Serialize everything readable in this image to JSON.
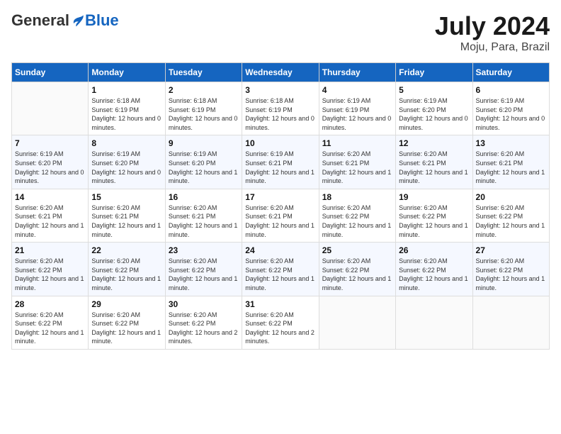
{
  "header": {
    "logo_general": "General",
    "logo_blue": "Blue",
    "month_title": "July 2024",
    "location": "Moju, Para, Brazil"
  },
  "days_of_week": [
    "Sunday",
    "Monday",
    "Tuesday",
    "Wednesday",
    "Thursday",
    "Friday",
    "Saturday"
  ],
  "weeks": [
    [
      {
        "day": "",
        "info": ""
      },
      {
        "day": "1",
        "info": "Sunrise: 6:18 AM\nSunset: 6:19 PM\nDaylight: 12 hours\nand 0 minutes."
      },
      {
        "day": "2",
        "info": "Sunrise: 6:18 AM\nSunset: 6:19 PM\nDaylight: 12 hours\nand 0 minutes."
      },
      {
        "day": "3",
        "info": "Sunrise: 6:18 AM\nSunset: 6:19 PM\nDaylight: 12 hours\nand 0 minutes."
      },
      {
        "day": "4",
        "info": "Sunrise: 6:19 AM\nSunset: 6:19 PM\nDaylight: 12 hours\nand 0 minutes."
      },
      {
        "day": "5",
        "info": "Sunrise: 6:19 AM\nSunset: 6:20 PM\nDaylight: 12 hours\nand 0 minutes."
      },
      {
        "day": "6",
        "info": "Sunrise: 6:19 AM\nSunset: 6:20 PM\nDaylight: 12 hours\nand 0 minutes."
      }
    ],
    [
      {
        "day": "7",
        "info": "Sunrise: 6:19 AM\nSunset: 6:20 PM\nDaylight: 12 hours\nand 0 minutes."
      },
      {
        "day": "8",
        "info": "Sunrise: 6:19 AM\nSunset: 6:20 PM\nDaylight: 12 hours\nand 0 minutes."
      },
      {
        "day": "9",
        "info": "Sunrise: 6:19 AM\nSunset: 6:20 PM\nDaylight: 12 hours\nand 1 minute."
      },
      {
        "day": "10",
        "info": "Sunrise: 6:19 AM\nSunset: 6:21 PM\nDaylight: 12 hours\nand 1 minute."
      },
      {
        "day": "11",
        "info": "Sunrise: 6:20 AM\nSunset: 6:21 PM\nDaylight: 12 hours\nand 1 minute."
      },
      {
        "day": "12",
        "info": "Sunrise: 6:20 AM\nSunset: 6:21 PM\nDaylight: 12 hours\nand 1 minute."
      },
      {
        "day": "13",
        "info": "Sunrise: 6:20 AM\nSunset: 6:21 PM\nDaylight: 12 hours\nand 1 minute."
      }
    ],
    [
      {
        "day": "14",
        "info": "Sunrise: 6:20 AM\nSunset: 6:21 PM\nDaylight: 12 hours\nand 1 minute."
      },
      {
        "day": "15",
        "info": "Sunrise: 6:20 AM\nSunset: 6:21 PM\nDaylight: 12 hours\nand 1 minute."
      },
      {
        "day": "16",
        "info": "Sunrise: 6:20 AM\nSunset: 6:21 PM\nDaylight: 12 hours\nand 1 minute."
      },
      {
        "day": "17",
        "info": "Sunrise: 6:20 AM\nSunset: 6:21 PM\nDaylight: 12 hours\nand 1 minute."
      },
      {
        "day": "18",
        "info": "Sunrise: 6:20 AM\nSunset: 6:22 PM\nDaylight: 12 hours\nand 1 minute."
      },
      {
        "day": "19",
        "info": "Sunrise: 6:20 AM\nSunset: 6:22 PM\nDaylight: 12 hours\nand 1 minute."
      },
      {
        "day": "20",
        "info": "Sunrise: 6:20 AM\nSunset: 6:22 PM\nDaylight: 12 hours\nand 1 minute."
      }
    ],
    [
      {
        "day": "21",
        "info": "Sunrise: 6:20 AM\nSunset: 6:22 PM\nDaylight: 12 hours\nand 1 minute."
      },
      {
        "day": "22",
        "info": "Sunrise: 6:20 AM\nSunset: 6:22 PM\nDaylight: 12 hours\nand 1 minute."
      },
      {
        "day": "23",
        "info": "Sunrise: 6:20 AM\nSunset: 6:22 PM\nDaylight: 12 hours\nand 1 minute."
      },
      {
        "day": "24",
        "info": "Sunrise: 6:20 AM\nSunset: 6:22 PM\nDaylight: 12 hours\nand 1 minute."
      },
      {
        "day": "25",
        "info": "Sunrise: 6:20 AM\nSunset: 6:22 PM\nDaylight: 12 hours\nand 1 minute."
      },
      {
        "day": "26",
        "info": "Sunrise: 6:20 AM\nSunset: 6:22 PM\nDaylight: 12 hours\nand 1 minute."
      },
      {
        "day": "27",
        "info": "Sunrise: 6:20 AM\nSunset: 6:22 PM\nDaylight: 12 hours\nand 1 minute."
      }
    ],
    [
      {
        "day": "28",
        "info": "Sunrise: 6:20 AM\nSunset: 6:22 PM\nDaylight: 12 hours\nand 1 minute."
      },
      {
        "day": "29",
        "info": "Sunrise: 6:20 AM\nSunset: 6:22 PM\nDaylight: 12 hours\nand 1 minute."
      },
      {
        "day": "30",
        "info": "Sunrise: 6:20 AM\nSunset: 6:22 PM\nDaylight: 12 hours\nand 2 minutes."
      },
      {
        "day": "31",
        "info": "Sunrise: 6:20 AM\nSunset: 6:22 PM\nDaylight: 12 hours\nand 2 minutes."
      },
      {
        "day": "",
        "info": ""
      },
      {
        "day": "",
        "info": ""
      },
      {
        "day": "",
        "info": ""
      }
    ]
  ]
}
